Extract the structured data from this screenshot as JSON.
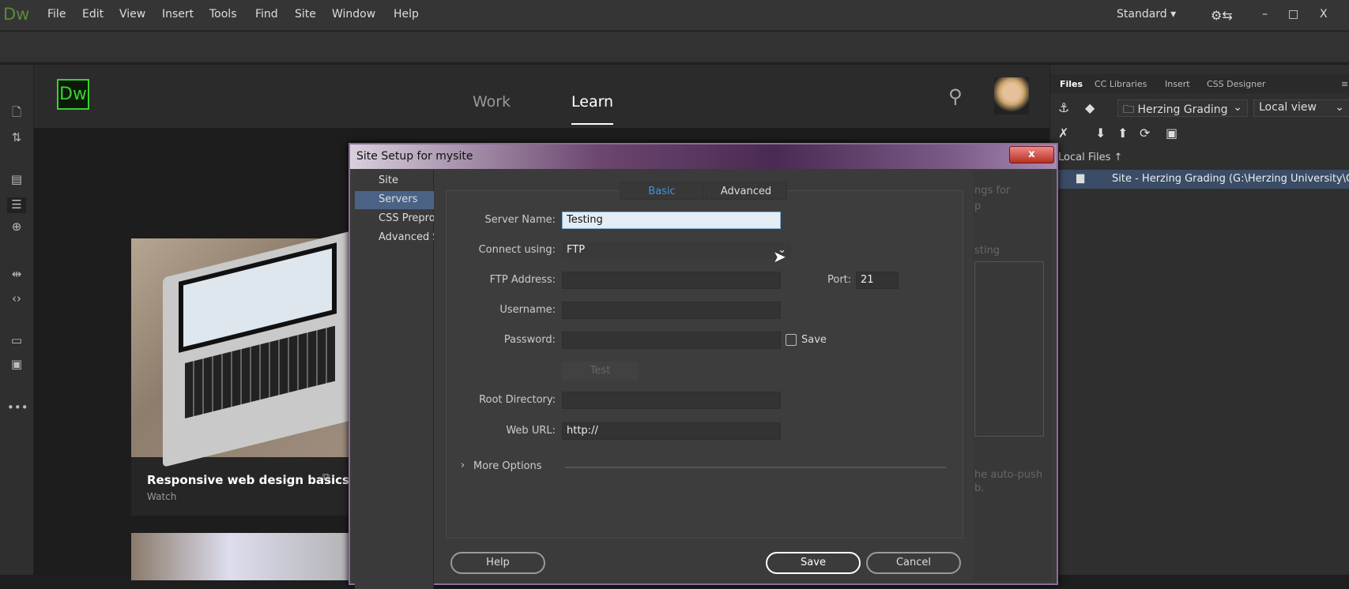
{
  "app": {
    "logo": "Dw",
    "menu": [
      "File",
      "Edit",
      "View",
      "Insert",
      "Tools",
      "Find",
      "Site",
      "Window",
      "Help"
    ],
    "workspace": "Standard",
    "window_controls": [
      "minimize",
      "maximize",
      "close"
    ]
  },
  "left_tools": [
    "new-file-icon",
    "file-transfer-icon",
    "live-view-inspect-icon",
    "dom-icon",
    "target-icon",
    "expand-icon",
    "code-tag-icon",
    "comment-icon",
    "comment-settings-icon",
    "more-icon"
  ],
  "learn": {
    "logo": "Dw",
    "tabs": [
      {
        "label": "Work"
      },
      {
        "label": "Learn",
        "active": true
      }
    ],
    "card": {
      "title": "Responsive web design basics",
      "subtitle": "Watch"
    }
  },
  "files_panel": {
    "tabs": [
      "Files",
      "CC Libraries",
      "Insert",
      "CSS Designer"
    ],
    "site_select": "Herzing Grading",
    "view_select": "Local view",
    "local_files": "Local Files ↑",
    "site_row": "Site - Herzing Grading (G:\\Herzing University\\G..."
  },
  "dialog": {
    "title": "Site Setup for mysite",
    "close": "x",
    "categories": [
      {
        "label": "Site"
      },
      {
        "label": "Servers",
        "selected": true
      },
      {
        "label": "CSS Preprocessors"
      },
      {
        "label": "Advanced Settings"
      }
    ],
    "tabs": [
      {
        "label": "Basic",
        "active": true
      },
      {
        "label": "Advanced"
      }
    ],
    "fields": {
      "server_name": {
        "label": "Server Name:",
        "value": "Testing"
      },
      "connect_using": {
        "label": "Connect using:",
        "value": "FTP"
      },
      "ftp_address": {
        "label": "FTP Address:",
        "value": ""
      },
      "port": {
        "label": "Port:",
        "value": "21"
      },
      "username": {
        "label": "Username:",
        "value": ""
      },
      "password": {
        "label": "Password:",
        "value": ""
      },
      "save_password": {
        "label": "Save",
        "checked": false
      },
      "test": "Test",
      "root_directory": {
        "label": "Root Directory:",
        "value": ""
      },
      "web_url": {
        "label": "Web URL:",
        "value": "http://"
      }
    },
    "more_options": "More Options",
    "buttons": {
      "help": "Help",
      "save": "Save",
      "cancel": "Cancel"
    },
    "background_text": [
      "ngs for",
      "p",
      "sting",
      "he auto-push",
      "b."
    ]
  },
  "colors": {
    "accent_green": "#3ad12a",
    "selection_blue": "#4a6385",
    "basic_tab": "#4a90d9"
  }
}
